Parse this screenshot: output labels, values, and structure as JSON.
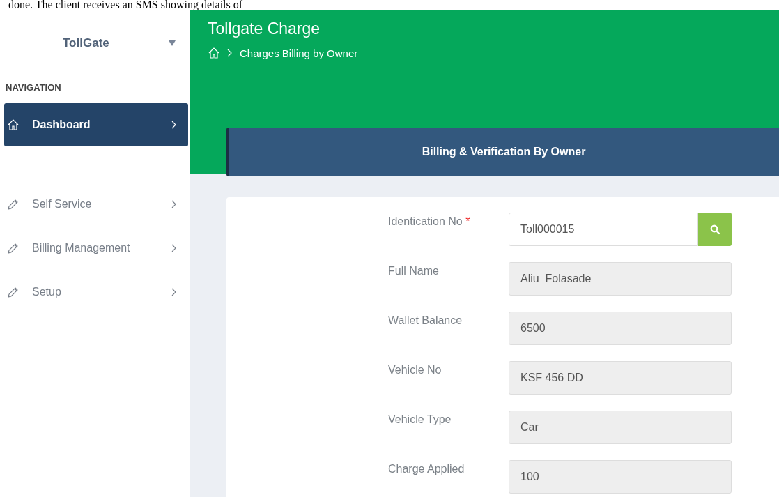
{
  "document_text": "done. The client receives an SMS showing details of",
  "sidebar": {
    "brand": "TollGate",
    "section_title": "NAVIGATION",
    "items": [
      {
        "label": "Dashboard",
        "kind": "home",
        "selected": true
      },
      {
        "label": "Self Service",
        "kind": "pencil",
        "selected": false
      },
      {
        "label": "Billing Management",
        "kind": "pencil",
        "selected": false
      },
      {
        "label": "Setup",
        "kind": "pencil",
        "selected": false
      }
    ]
  },
  "header": {
    "title": "Tollgate Charge",
    "breadcrumb": "Charges Billing by Owner"
  },
  "panel": {
    "title": "Billing & Verification By Owner"
  },
  "form": {
    "fields": [
      {
        "label": "Identication No",
        "required_mark": "*",
        "value": "Toll000015",
        "kind": "search"
      },
      {
        "label": "Full Name",
        "value": "Aliu  Folasade",
        "kind": "readonly"
      },
      {
        "label": "Wallet Balance",
        "value": "6500",
        "kind": "readonly"
      },
      {
        "label": "Vehicle No",
        "value": "KSF 456 DD",
        "kind": "readonly"
      },
      {
        "label": "Vehicle Type",
        "value": "Car",
        "kind": "readonly"
      },
      {
        "label": "Charge Applied",
        "value": "100",
        "kind": "readonly"
      }
    ]
  }
}
